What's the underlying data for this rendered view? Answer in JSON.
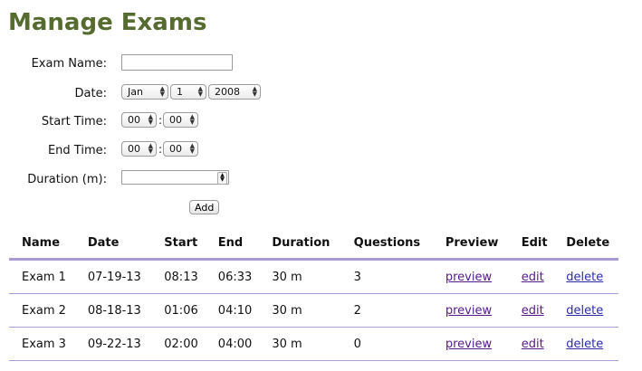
{
  "page": {
    "title": "Manage Exams"
  },
  "form": {
    "exam_name_label": "Exam Name:",
    "exam_name_value": "",
    "date_label": "Date:",
    "date_month": "Jan",
    "date_day": "1",
    "date_year": "2008",
    "start_label": "Start Time:",
    "start_hour": "00",
    "start_min": "00",
    "end_label": "End Time:",
    "end_hour": "00",
    "end_min": "00",
    "duration_label": "Duration (m):",
    "duration_value": "",
    "time_separator": ":",
    "add_label": "Add"
  },
  "table": {
    "headers": [
      "Name",
      "Date",
      "Start",
      "End",
      "Duration",
      "Questions",
      "Preview",
      "Edit",
      "Delete"
    ],
    "rows": [
      {
        "name": "Exam 1",
        "date": "07-19-13",
        "start": "08:13",
        "end": "06:33",
        "duration": "30 m",
        "questions": "3",
        "preview": "preview",
        "edit": "edit",
        "delete": "delete"
      },
      {
        "name": "Exam 2",
        "date": "08-18-13",
        "start": "01:06",
        "end": "04:10",
        "duration": "30 m",
        "questions": "2",
        "preview": "preview",
        "edit": "edit",
        "delete": "delete"
      },
      {
        "name": "Exam 3",
        "date": "09-22-13",
        "start": "02:00",
        "end": "04:00",
        "duration": "30 m",
        "questions": "0",
        "preview": "preview",
        "edit": "edit",
        "delete": "delete"
      }
    ]
  },
  "colors": {
    "title": "#556b2f",
    "divider": "#a99bd1",
    "link": "#2b2ba8",
    "visited_link": "#551a8b"
  },
  "icons": {
    "select_arrow": "updown-arrows-icon",
    "spinner": "spinner-arrows-icon"
  }
}
